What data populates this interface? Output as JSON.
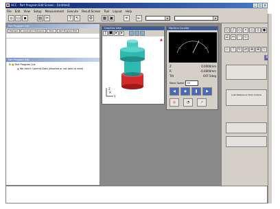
{
  "window": {
    "title": "HCC - Part Program Edit Screen - [Untitled]"
  },
  "menu": [
    "File",
    "Edit",
    "View",
    "Setup",
    "Measurement",
    "Execute",
    "Result Screen",
    "Tool",
    "Layout",
    "Help"
  ],
  "toolbar": {
    "icons": [
      "new-icon",
      "open-icon",
      "save-icon",
      "print-icon",
      "cut-icon",
      "paste-icon",
      "help-icon",
      "probe-icon",
      "settings-icon"
    ]
  },
  "left_panel": {
    "header": "Part Program List",
    "tabs": [
      "Element",
      "Geometric Tolerance",
      "Tools",
      "Part Program Edit"
    ],
    "tree_header": "Part Program Edit",
    "root": "Part Program List",
    "warning": "We didn't Commit Data (Aborted or not able to read)"
  },
  "graphics_window": {
    "title": "Graphics View",
    "axis_labels": [
      "Z",
      "X",
      "Y"
    ]
  },
  "dro_window": {
    "title": "Machine Counter",
    "z_label": "Z",
    "z_value": "0.0000mm",
    "r_label": "R",
    "r_value": "-0.0000mm",
    "tilt_label": "Tilt",
    "tilt_value": "047.5deg",
    "speed_label": "Move Speed",
    "speed_value": "50"
  },
  "right_panel": {
    "buttons": [
      "",
      "Load Reference Tools Criteria",
      "",
      ""
    ]
  },
  "colors": {
    "title_bar": "#0a246a",
    "part_body": "#2fb8b0",
    "part_base": "#d42a2a",
    "panel_bg": "#d4d0c8",
    "workspace_bg": "#8a8a8a"
  }
}
